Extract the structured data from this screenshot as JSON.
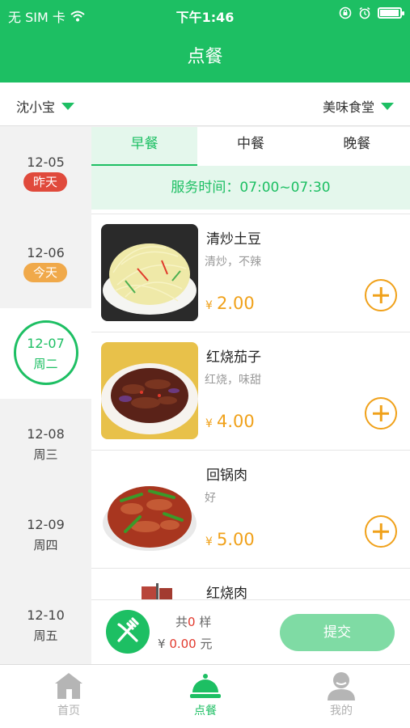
{
  "status": {
    "carrier": "无 SIM 卡",
    "time": "下午1:46",
    "battery_level": 0.95
  },
  "header": {
    "title": "点餐"
  },
  "selector": {
    "user": "沈小宝",
    "canteen": "美味食堂"
  },
  "dates": [
    {
      "date": "12-05",
      "label": "昨天",
      "label_color": "#e04a3c"
    },
    {
      "date": "12-06",
      "label": "今天",
      "label_color": "#f0a94a"
    },
    {
      "date": "12-07",
      "label": "周二",
      "active": true
    },
    {
      "date": "12-08",
      "label": "周三"
    },
    {
      "date": "12-09",
      "label": "周四"
    },
    {
      "date": "12-10",
      "label": "周五"
    }
  ],
  "meal_tabs": [
    {
      "label": "早餐",
      "active": true
    },
    {
      "label": "中餐"
    },
    {
      "label": "晚餐"
    }
  ],
  "service_time": "服务时间：07:00~07:30",
  "dishes": [
    {
      "name": "清炒土豆",
      "desc": "清炒，不辣",
      "currency": "¥",
      "price": "2.00",
      "image": "shredded-potato-image"
    },
    {
      "name": "红烧茄子",
      "desc": "红烧，味甜",
      "currency": "¥",
      "price": "4.00",
      "image": "braised-eggplant-image"
    },
    {
      "name": "回锅肉",
      "desc": "好",
      "currency": "¥",
      "price": "5.00",
      "image": "twice-cooked-pork-image"
    },
    {
      "name": "红烧肉",
      "desc": "",
      "currency": "¥",
      "price": "",
      "image": "braised-pork-image"
    }
  ],
  "order": {
    "count_prefix": "共",
    "count": "0",
    "count_unit": "样",
    "currency": "¥",
    "total": "0.00",
    "total_unit": "元",
    "submit_label": "提交"
  },
  "nav": [
    {
      "label": "首页",
      "icon": "home-icon"
    },
    {
      "label": "点餐",
      "icon": "cloche-icon",
      "active": true
    },
    {
      "label": "我的",
      "icon": "person-icon"
    }
  ],
  "colors": {
    "brand": "#1dbf63",
    "price": "#f0a11a",
    "alert": "#e23a2e"
  }
}
